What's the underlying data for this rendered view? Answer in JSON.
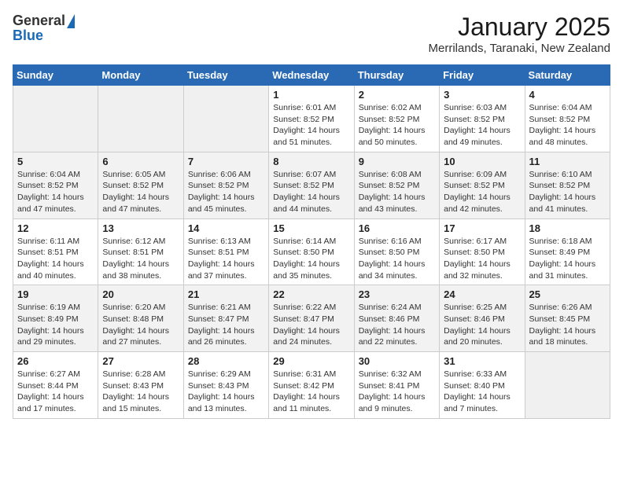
{
  "header": {
    "logo_general": "General",
    "logo_blue": "Blue",
    "month_title": "January 2025",
    "location": "Merrilands, Taranaki, New Zealand"
  },
  "days_of_week": [
    "Sunday",
    "Monday",
    "Tuesday",
    "Wednesday",
    "Thursday",
    "Friday",
    "Saturday"
  ],
  "weeks": [
    {
      "cells": [
        {
          "day": "",
          "info": ""
        },
        {
          "day": "",
          "info": ""
        },
        {
          "day": "",
          "info": ""
        },
        {
          "day": "1",
          "info": "Sunrise: 6:01 AM\nSunset: 8:52 PM\nDaylight: 14 hours\nand 51 minutes."
        },
        {
          "day": "2",
          "info": "Sunrise: 6:02 AM\nSunset: 8:52 PM\nDaylight: 14 hours\nand 50 minutes."
        },
        {
          "day": "3",
          "info": "Sunrise: 6:03 AM\nSunset: 8:52 PM\nDaylight: 14 hours\nand 49 minutes."
        },
        {
          "day": "4",
          "info": "Sunrise: 6:04 AM\nSunset: 8:52 PM\nDaylight: 14 hours\nand 48 minutes."
        }
      ]
    },
    {
      "cells": [
        {
          "day": "5",
          "info": "Sunrise: 6:04 AM\nSunset: 8:52 PM\nDaylight: 14 hours\nand 47 minutes."
        },
        {
          "day": "6",
          "info": "Sunrise: 6:05 AM\nSunset: 8:52 PM\nDaylight: 14 hours\nand 47 minutes."
        },
        {
          "day": "7",
          "info": "Sunrise: 6:06 AM\nSunset: 8:52 PM\nDaylight: 14 hours\nand 45 minutes."
        },
        {
          "day": "8",
          "info": "Sunrise: 6:07 AM\nSunset: 8:52 PM\nDaylight: 14 hours\nand 44 minutes."
        },
        {
          "day": "9",
          "info": "Sunrise: 6:08 AM\nSunset: 8:52 PM\nDaylight: 14 hours\nand 43 minutes."
        },
        {
          "day": "10",
          "info": "Sunrise: 6:09 AM\nSunset: 8:52 PM\nDaylight: 14 hours\nand 42 minutes."
        },
        {
          "day": "11",
          "info": "Sunrise: 6:10 AM\nSunset: 8:52 PM\nDaylight: 14 hours\nand 41 minutes."
        }
      ]
    },
    {
      "cells": [
        {
          "day": "12",
          "info": "Sunrise: 6:11 AM\nSunset: 8:51 PM\nDaylight: 14 hours\nand 40 minutes."
        },
        {
          "day": "13",
          "info": "Sunrise: 6:12 AM\nSunset: 8:51 PM\nDaylight: 14 hours\nand 38 minutes."
        },
        {
          "day": "14",
          "info": "Sunrise: 6:13 AM\nSunset: 8:51 PM\nDaylight: 14 hours\nand 37 minutes."
        },
        {
          "day": "15",
          "info": "Sunrise: 6:14 AM\nSunset: 8:50 PM\nDaylight: 14 hours\nand 35 minutes."
        },
        {
          "day": "16",
          "info": "Sunrise: 6:16 AM\nSunset: 8:50 PM\nDaylight: 14 hours\nand 34 minutes."
        },
        {
          "day": "17",
          "info": "Sunrise: 6:17 AM\nSunset: 8:50 PM\nDaylight: 14 hours\nand 32 minutes."
        },
        {
          "day": "18",
          "info": "Sunrise: 6:18 AM\nSunset: 8:49 PM\nDaylight: 14 hours\nand 31 minutes."
        }
      ]
    },
    {
      "cells": [
        {
          "day": "19",
          "info": "Sunrise: 6:19 AM\nSunset: 8:49 PM\nDaylight: 14 hours\nand 29 minutes."
        },
        {
          "day": "20",
          "info": "Sunrise: 6:20 AM\nSunset: 8:48 PM\nDaylight: 14 hours\nand 27 minutes."
        },
        {
          "day": "21",
          "info": "Sunrise: 6:21 AM\nSunset: 8:47 PM\nDaylight: 14 hours\nand 26 minutes."
        },
        {
          "day": "22",
          "info": "Sunrise: 6:22 AM\nSunset: 8:47 PM\nDaylight: 14 hours\nand 24 minutes."
        },
        {
          "day": "23",
          "info": "Sunrise: 6:24 AM\nSunset: 8:46 PM\nDaylight: 14 hours\nand 22 minutes."
        },
        {
          "day": "24",
          "info": "Sunrise: 6:25 AM\nSunset: 8:46 PM\nDaylight: 14 hours\nand 20 minutes."
        },
        {
          "day": "25",
          "info": "Sunrise: 6:26 AM\nSunset: 8:45 PM\nDaylight: 14 hours\nand 18 minutes."
        }
      ]
    },
    {
      "cells": [
        {
          "day": "26",
          "info": "Sunrise: 6:27 AM\nSunset: 8:44 PM\nDaylight: 14 hours\nand 17 minutes."
        },
        {
          "day": "27",
          "info": "Sunrise: 6:28 AM\nSunset: 8:43 PM\nDaylight: 14 hours\nand 15 minutes."
        },
        {
          "day": "28",
          "info": "Sunrise: 6:29 AM\nSunset: 8:43 PM\nDaylight: 14 hours\nand 13 minutes."
        },
        {
          "day": "29",
          "info": "Sunrise: 6:31 AM\nSunset: 8:42 PM\nDaylight: 14 hours\nand 11 minutes."
        },
        {
          "day": "30",
          "info": "Sunrise: 6:32 AM\nSunset: 8:41 PM\nDaylight: 14 hours\nand 9 minutes."
        },
        {
          "day": "31",
          "info": "Sunrise: 6:33 AM\nSunset: 8:40 PM\nDaylight: 14 hours\nand 7 minutes."
        },
        {
          "day": "",
          "info": ""
        }
      ]
    }
  ]
}
